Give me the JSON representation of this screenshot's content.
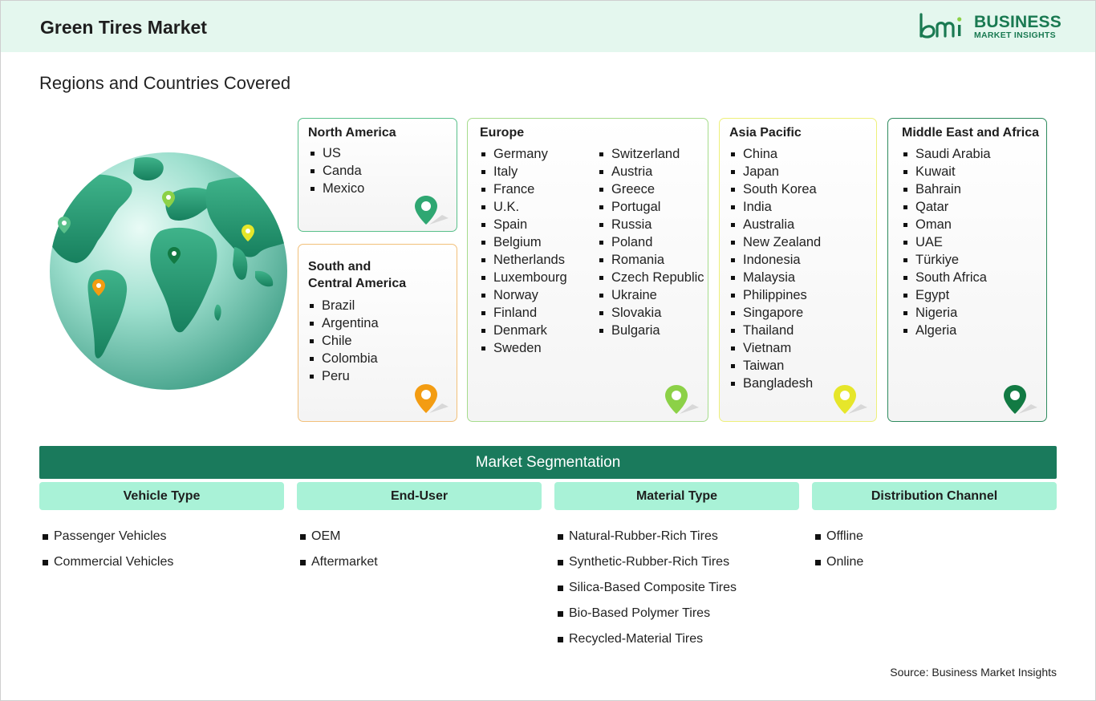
{
  "header": {
    "title": "Green Tires Market",
    "logo_line1": "BUSINESS",
    "logo_line2": "MARKET INSIGHTS",
    "logo_mark": "bmi"
  },
  "subtitle": "Regions and Countries Covered",
  "colors": {
    "header_bg": "#e4f7ee",
    "brand_green": "#1a7a52",
    "segment_bar": "#1a7a5c",
    "segment_head": "#a9f2d7",
    "na_border": "#59c08a",
    "sca_border": "#f2c07a",
    "eu_border": "#a6dc8c",
    "ap_border": "#eef07a",
    "mea_border": "#2e8b5e"
  },
  "regions": {
    "north_america": {
      "title": "North America",
      "countries": [
        "US",
        "Canda",
        "Mexico"
      ],
      "pin_color": "#2fa772"
    },
    "south_central_america": {
      "title_line1": "South and",
      "title_line2": "Central America",
      "countries": [
        "Brazil",
        "Argentina",
        "Chile",
        "Colombia",
        "Peru"
      ],
      "pin_color": "#f39c12"
    },
    "europe": {
      "title": "Europe",
      "countries_col1": [
        "Germany",
        "Italy",
        "France",
        "U.K.",
        "Spain",
        "Belgium",
        "Netherlands",
        "Luxembourg",
        "Norway",
        "Finland",
        "Denmark",
        "Sweden"
      ],
      "countries_col2": [
        "Switzerland",
        "Austria",
        "Greece",
        "Portugal",
        "Russia",
        "Poland",
        "Romania",
        "Czech Republic",
        "Ukraine",
        "Slovakia",
        "Bulgaria"
      ],
      "pin_color": "#8cd147"
    },
    "asia_pacific": {
      "title": "Asia Pacific",
      "countries": [
        "China",
        "Japan",
        "South Korea",
        "India",
        "Australia",
        "New Zealand",
        "Indonesia",
        "Malaysia",
        "Philippines",
        "Singapore",
        "Thailand",
        "Vietnam",
        "Taiwan",
        "Bangladesh"
      ],
      "pin_color": "#e6e62a"
    },
    "mea": {
      "title": "Middle East and Africa",
      "countries": [
        "Saudi Arabia",
        "Kuwait",
        "Bahrain",
        "Qatar",
        "Oman",
        "UAE",
        "Türkiye",
        "South Africa",
        "Egypt",
        "Nigeria",
        "Algeria"
      ],
      "pin_color": "#127a43"
    }
  },
  "segmentation": {
    "title": "Market Segmentation",
    "columns": [
      {
        "heading": "Vehicle Type",
        "items": [
          "Passenger Vehicles",
          "Commercial Vehicles"
        ]
      },
      {
        "heading": "End-User",
        "items": [
          "OEM",
          "Aftermarket"
        ]
      },
      {
        "heading": "Material Type",
        "items": [
          "Natural-Rubber-Rich Tires",
          "Synthetic-Rubber-Rich Tires",
          "Silica-Based Composite Tires",
          "Bio-Based Polymer Tires",
          "Recycled-Material Tires"
        ]
      },
      {
        "heading": "Distribution Channel",
        "items": [
          "Offline",
          "Online"
        ]
      }
    ]
  },
  "source": "Source: Business Market Insights"
}
